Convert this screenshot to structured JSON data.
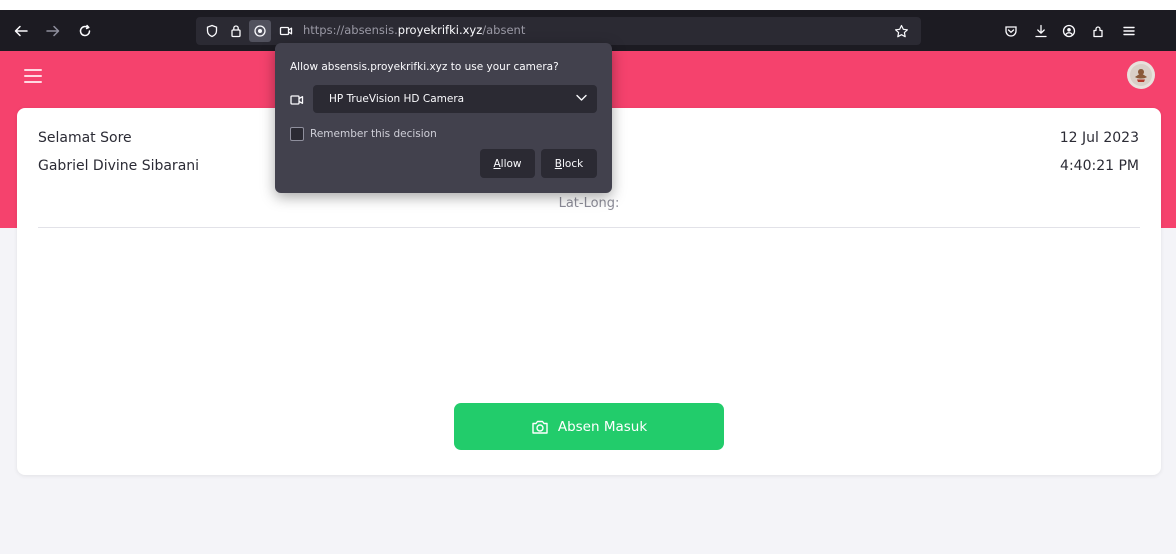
{
  "browser": {
    "url_prefix": "https://absensis.",
    "url_host": "proyekrifki.xyz",
    "url_path": "/absent"
  },
  "permission_popup": {
    "title": "Allow absensis.proyekrifki.xyz to use your camera?",
    "selected_camera": "HP TrueVision HD Camera",
    "remember_label": "Remember this decision",
    "remember_checked": false,
    "allow_label": "Allow",
    "block_label": "Block"
  },
  "card": {
    "greeting": "Selamat Sore",
    "username": "Gabriel Divine Sibarani",
    "date": "12 Jul 2023",
    "time": "4:40:21 PM",
    "latlong_label": "Lat-Long:",
    "absen_button_label": "Absen Masuk"
  },
  "colors": {
    "header": "#f5426d",
    "button": "#22cc6b",
    "chrome": "#1c1b22",
    "popup": "#42414d"
  },
  "icons": {
    "back": "back-arrow-icon",
    "forward": "forward-arrow-icon",
    "reload": "reload-icon",
    "shield": "shield-icon",
    "lock": "lock-icon",
    "location": "location-icon",
    "camera": "camera-icon",
    "star": "star-icon",
    "pocket": "pocket-icon",
    "download": "download-icon",
    "account": "account-icon",
    "extensions": "extensions-icon",
    "menu": "menu-icon"
  }
}
